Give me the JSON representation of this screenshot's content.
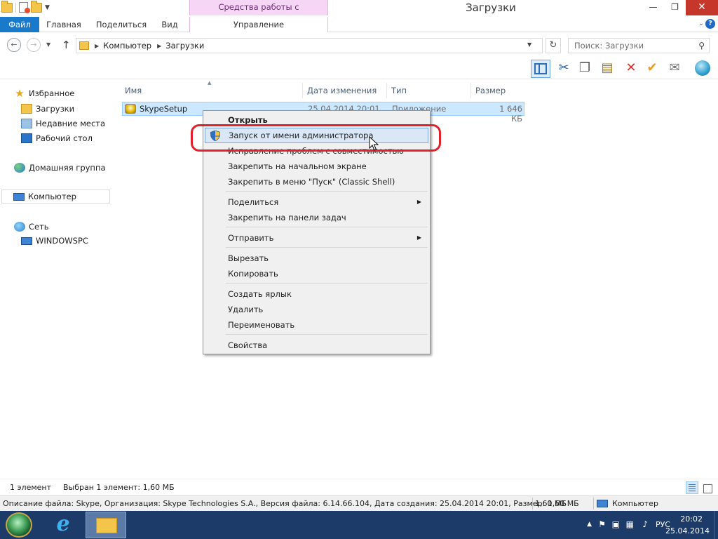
{
  "titlebar": {
    "title": "Загрузки",
    "context_group": "Средства работы с приложениями",
    "controls": {
      "minimize": "—",
      "maximize": "❐",
      "close": "✕"
    }
  },
  "ribbon": {
    "tabs": [
      "Файл",
      "Главная",
      "Поделиться",
      "Вид",
      "Управление"
    ],
    "help": "?"
  },
  "address": {
    "breadcrumbs": [
      "Компьютер",
      "Загрузки"
    ],
    "search_placeholder": "Поиск: Загрузки"
  },
  "toolbar_icons": [
    "layout-icon",
    "cut-icon",
    "copy-icon",
    "paste-icon",
    "delete-icon",
    "properties-icon",
    "email-icon",
    "classic-shell-icon"
  ],
  "navpane": {
    "favorites": "Избранное",
    "downloads": "Загрузки",
    "recent": "Недавние места",
    "desktop": "Рабочий стол",
    "homegroup": "Домашняя группа",
    "computer": "Компьютер",
    "network": "Сеть",
    "network_pc": "WINDOWSPC"
  },
  "columns": {
    "name": "Имя",
    "date": "Дата изменения",
    "type": "Тип",
    "size": "Размер"
  },
  "file": {
    "name": "SkypeSetup",
    "date": "25.04.2014 20:01",
    "type": "Приложение",
    "size": "1 646 КБ"
  },
  "context_menu": {
    "open": "Открыть",
    "run_as_admin": "Запуск от имени администратора",
    "troubleshoot": "Исправление проблем с совместимостью",
    "pin_start": "Закрепить на начальном экране",
    "pin_classic": "Закрепить в меню \"Пуск\" (Classic Shell)",
    "share": "Поделиться",
    "pin_taskbar": "Закрепить на панели задач",
    "send_to": "Отправить",
    "cut": "Вырезать",
    "copy": "Копировать",
    "create_shortcut": "Создать ярлык",
    "delete": "Удалить",
    "rename": "Переименовать",
    "properties": "Свойства"
  },
  "status": {
    "count": "1 элемент",
    "selected": "Выбран 1 элемент: 1,60 МБ"
  },
  "infobar": {
    "description": "Описание файла: Skype, Организация: Skype Technologies S.A., Версия файла: 6.14.66.104, Дата создания: 25.04.2014 20:01, Размер: 1,60 МБ",
    "size": "1,60 МБ",
    "location": "Компьютер"
  },
  "tray": {
    "language": "РУС",
    "time": "20:02",
    "date": "25.04.2014"
  },
  "colors": {
    "file_tab": "#1979ca",
    "context_tab_band": "#f5d6f5",
    "selection": "#cce8ff",
    "highlight_ring": "#e0202a",
    "taskbar": "#1c3b69"
  }
}
